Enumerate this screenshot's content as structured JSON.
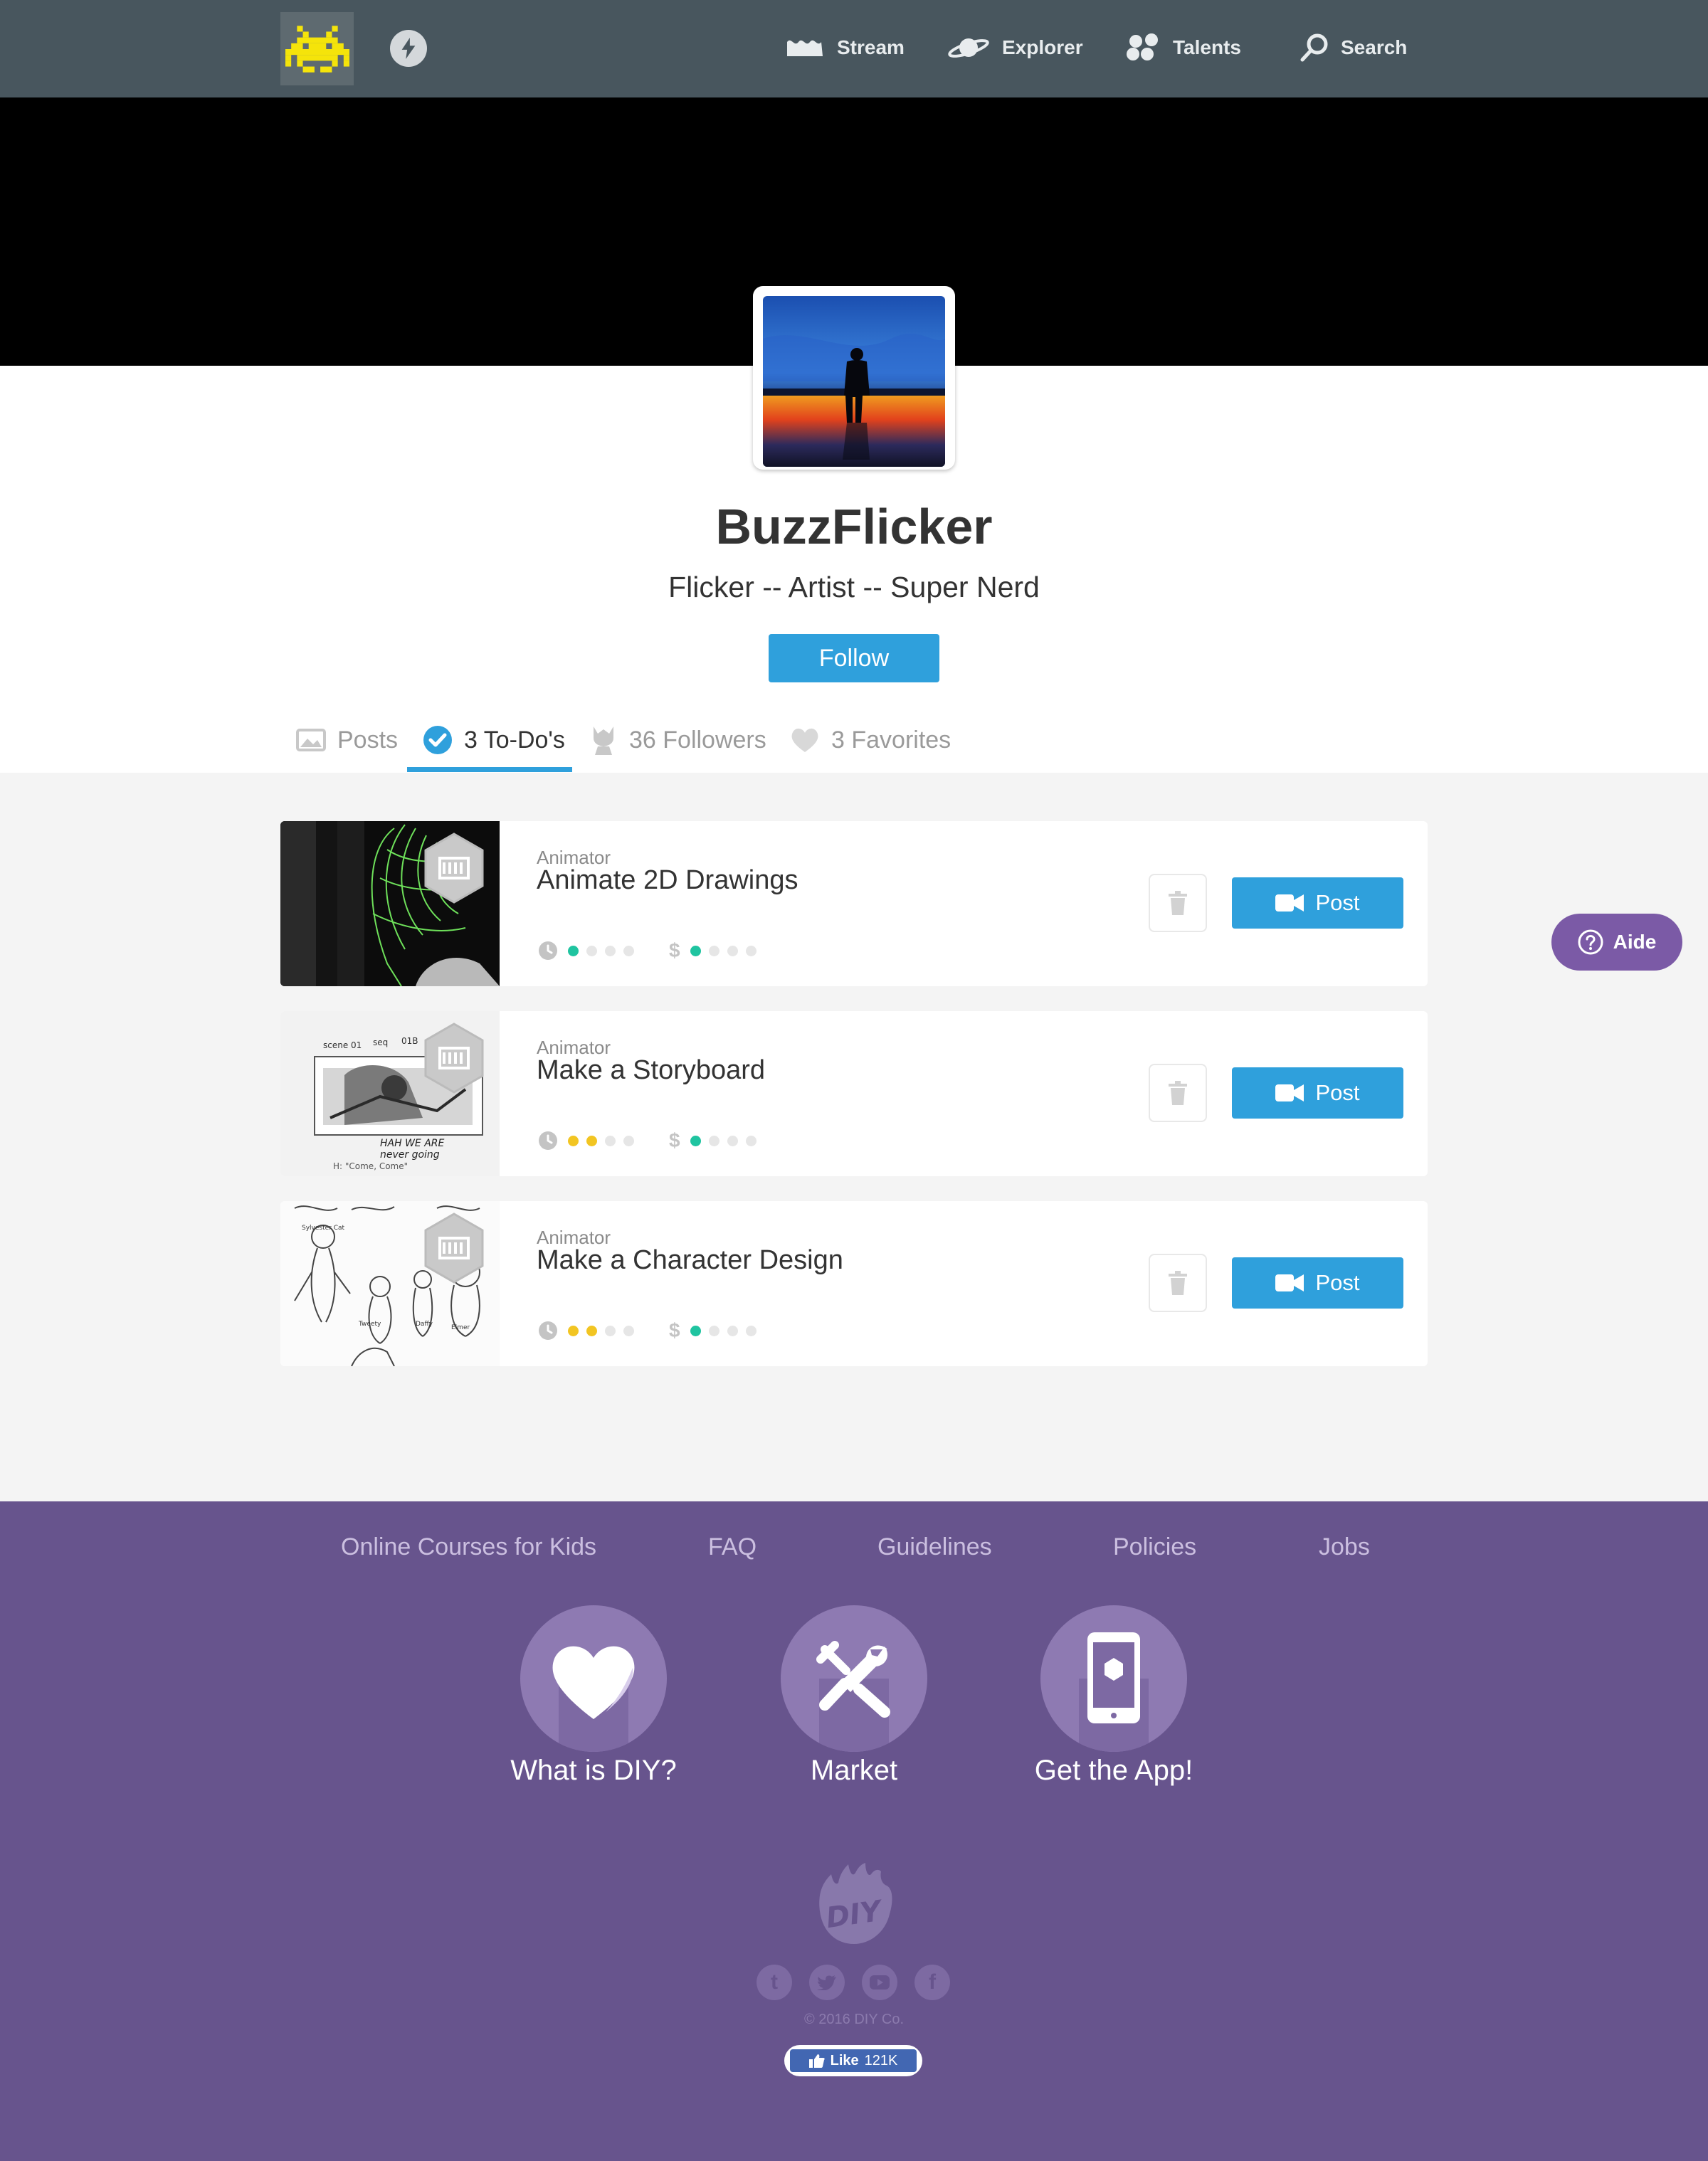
{
  "nav": {
    "logo_icon": "space-invader-icon",
    "activity_icon": "lightning-icon",
    "items": [
      {
        "label": "Stream",
        "icon": "stream-icon"
      },
      {
        "label": "Explorer",
        "icon": "planet-icon"
      },
      {
        "label": "Talents",
        "icon": "talents-icon"
      },
      {
        "label": "Search",
        "icon": "search-icon"
      }
    ]
  },
  "profile": {
    "username": "BuzzFlicker",
    "tagline": "Flicker -- Artist -- Super Nerd",
    "follow_label": "Follow"
  },
  "tabs": [
    {
      "label": "Posts",
      "icon": "image-icon",
      "active": false
    },
    {
      "label": "3 To-Do's",
      "icon": "check-circle-icon",
      "active": true
    },
    {
      "label": "36 Followers",
      "icon": "follower-icon",
      "active": false
    },
    {
      "label": "3 Favorites",
      "icon": "heart-icon",
      "active": false
    }
  ],
  "todos": [
    {
      "category": "Animator",
      "title": "Animate 2D Drawings",
      "time_level": 1,
      "cost_level": 1,
      "post_label": "Post"
    },
    {
      "category": "Animator",
      "title": "Make a Storyboard",
      "time_level": 2,
      "cost_level": 1,
      "post_label": "Post"
    },
    {
      "category": "Animator",
      "title": "Make a Character Design",
      "time_level": 2,
      "cost_level": 1,
      "post_label": "Post"
    }
  ],
  "meta_scale": 4,
  "colors": {
    "brand": "#2fa0dc",
    "time_dot": "#f2c522",
    "time_dot_first": "#1fc4a0",
    "cost_dot": "#1fc4a0",
    "footer": "#67548d"
  },
  "aide": {
    "label": "Aide"
  },
  "footer": {
    "links": [
      "Online Courses for Kids",
      "FAQ",
      "Guidelines",
      "Policies",
      "Jobs"
    ],
    "features": [
      {
        "label": "What is DIY?",
        "icon": "heart-icon"
      },
      {
        "label": "Market",
        "icon": "tools-icon"
      },
      {
        "label": "Get the App!",
        "icon": "phone-icon"
      }
    ],
    "logo_text": "DIY",
    "social": [
      "t",
      "twitter",
      "youtube",
      "f"
    ],
    "copyright": "© 2016 DIY Co.",
    "like_label": "Like",
    "like_count": "121K"
  }
}
